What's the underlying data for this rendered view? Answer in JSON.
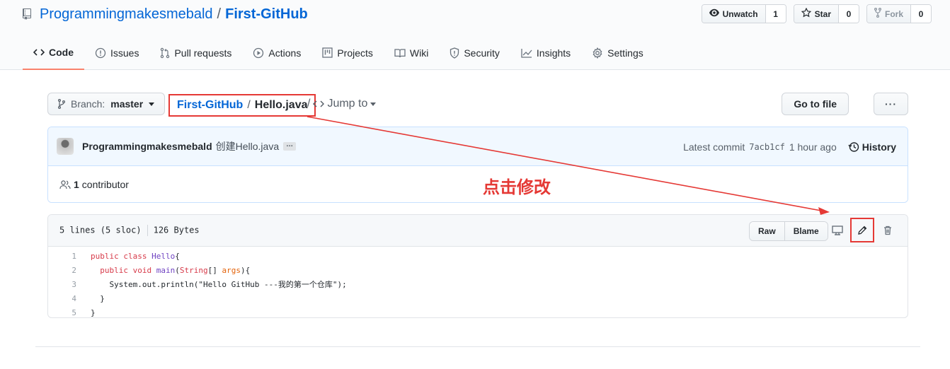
{
  "repo": {
    "owner": "Programmingmakesmebald",
    "separator": "/",
    "name": "First-GitHub"
  },
  "actions": {
    "unwatch_label": "Unwatch",
    "unwatch_count": "1",
    "star_label": "Star",
    "star_count": "0",
    "fork_label": "Fork",
    "fork_count": "0"
  },
  "tabs": [
    {
      "label": "Code",
      "icon": "code-icon"
    },
    {
      "label": "Issues",
      "icon": "issue-icon"
    },
    {
      "label": "Pull requests",
      "icon": "pull-request-icon"
    },
    {
      "label": "Actions",
      "icon": "play-icon"
    },
    {
      "label": "Projects",
      "icon": "project-icon"
    },
    {
      "label": "Wiki",
      "icon": "book-icon"
    },
    {
      "label": "Security",
      "icon": "shield-icon"
    },
    {
      "label": "Insights",
      "icon": "graph-icon"
    },
    {
      "label": "Settings",
      "icon": "gear-icon"
    }
  ],
  "filenav": {
    "branch_label": "Branch:",
    "branch_value": "master",
    "crumb_repo": "First-GitHub",
    "crumb_sep": "/",
    "crumb_file": "Hello.java",
    "after_sep": "/",
    "jump_to": "Jump to",
    "go_to_file": "Go to file",
    "more": "···"
  },
  "commit": {
    "author": "Programmingmakesmebald",
    "message": "创建Hello.java",
    "ellipsis": "…",
    "latest_label": "Latest commit",
    "sha": "7acb1cf",
    "time": "1 hour ago",
    "history_label": "History",
    "contributors_count": "1",
    "contributors_label": "contributor"
  },
  "annotation": "点击修改",
  "file": {
    "lines_info": "5 lines (5 sloc)",
    "size": "126 Bytes",
    "raw_label": "Raw",
    "blame_label": "Blame"
  },
  "code_lines": [
    {
      "n": "1",
      "text": "public class Hello{"
    },
    {
      "n": "2",
      "text": "  public void main(String[] args){"
    },
    {
      "n": "3",
      "text": "    System.out.println(\"Hello GitHub ---我的第一个仓库\");"
    },
    {
      "n": "4",
      "text": "  }"
    },
    {
      "n": "5",
      "text": "}"
    }
  ],
  "colors": {
    "link": "#0366d6",
    "annotation_red": "#e53935",
    "active_tab_border": "#f9826c"
  }
}
